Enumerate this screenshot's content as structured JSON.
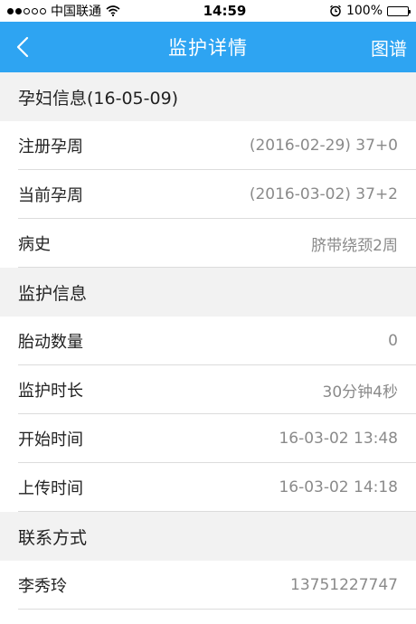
{
  "status_bar": {
    "carrier": "中国联通",
    "time": "14:59",
    "battery": "100%"
  },
  "nav": {
    "back_icon": "chevron-left-icon",
    "title": "监护详情",
    "right_label": "图谱"
  },
  "sections": [
    {
      "header": "孕妇信息(16-05-09)",
      "rows": [
        {
          "label": "注册孕周",
          "value": "(2016-02-29) 37+0"
        },
        {
          "label": "当前孕周",
          "value": "(2016-03-02) 37+2"
        },
        {
          "label": "病史",
          "value": "脐带绕颈2周"
        }
      ]
    },
    {
      "header": "监护信息",
      "rows": [
        {
          "label": "胎动数量",
          "value": "0"
        },
        {
          "label": "监护时长",
          "value": "30分钟4秒"
        },
        {
          "label": "开始时间",
          "value": "16-03-02 13:48"
        },
        {
          "label": "上传时间",
          "value": "16-03-02 14:18"
        }
      ]
    },
    {
      "header": "联系方式",
      "rows": [
        {
          "label": "李秀玲",
          "value": "13751227747"
        }
      ]
    }
  ],
  "colors": {
    "accent": "#2ea4f2",
    "section_bg": "#f2f2f2",
    "value_text": "#8a8a8a"
  }
}
